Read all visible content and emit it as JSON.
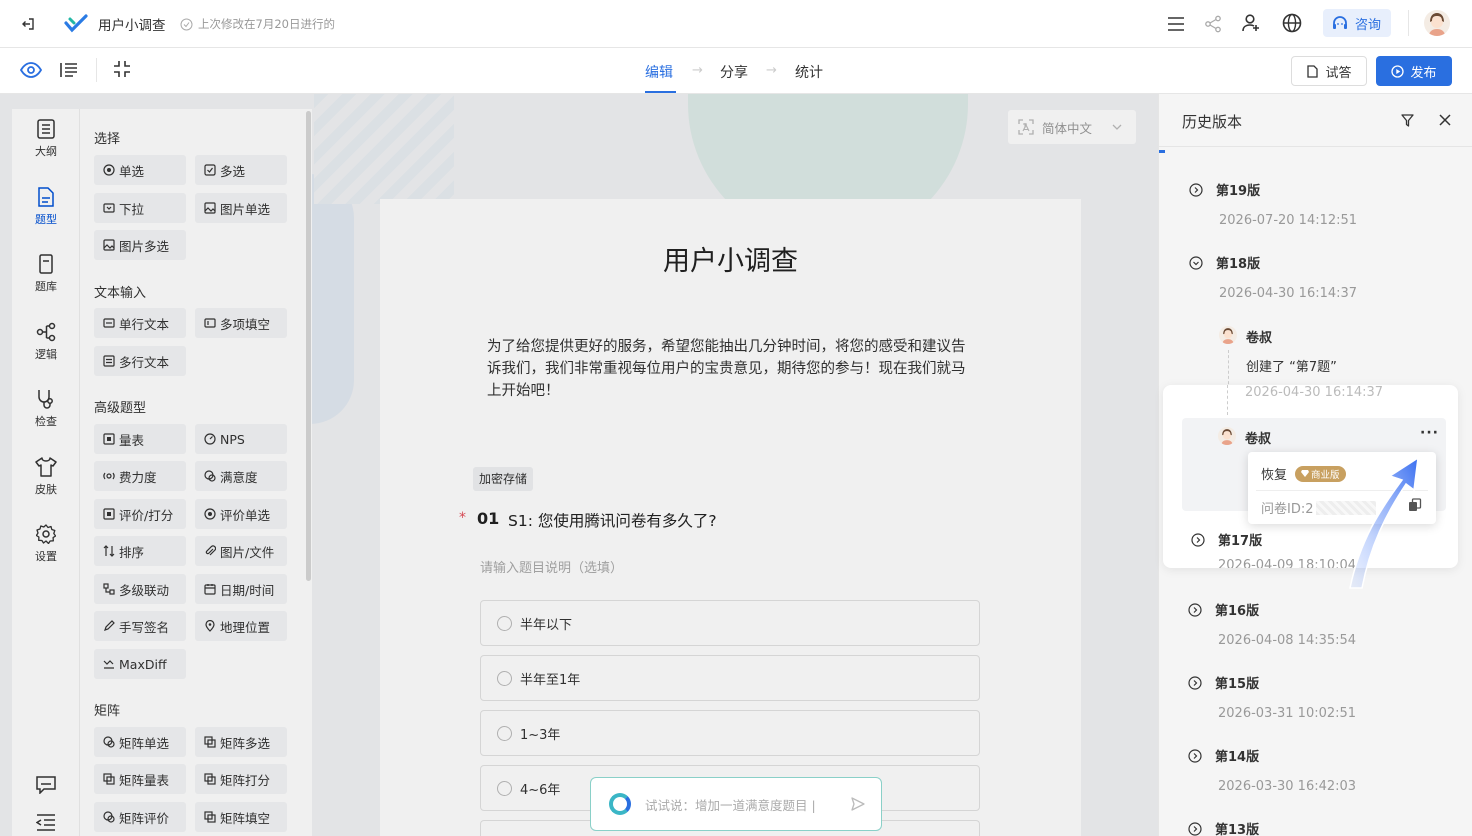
{
  "header": {
    "title": "用户小调查",
    "last_modified": "上次修改在7月20日进行的",
    "consult_label": "咨询"
  },
  "steps": {
    "edit": "编辑",
    "share": "分享",
    "stats": "统计"
  },
  "actions": {
    "preview": "试答",
    "publish": "发布"
  },
  "nav": {
    "outline": "大纲",
    "types": "题型",
    "bank": "题库",
    "logic": "逻辑",
    "check": "检查",
    "skin": "皮肤",
    "settings": "设置"
  },
  "palette": {
    "s1": "选择",
    "single": "单选",
    "multi": "多选",
    "dropdown": "下拉",
    "img_single": "图片单选",
    "img_multi": "图片多选",
    "s2": "文本输入",
    "single_text": "单行文本",
    "multi_fill": "多项填空",
    "multi_text": "多行文本",
    "s3": "高级题型",
    "scale": "量表",
    "nps": "NPS",
    "effort": "费力度",
    "satisfaction": "满意度",
    "rating": "评价/打分",
    "rating_single": "评价单选",
    "sort": "排序",
    "file": "图片/文件",
    "cascade": "多级联动",
    "datetime": "日期/时间",
    "signature": "手写签名",
    "location": "地理位置",
    "maxdiff": "MaxDiff",
    "s4": "矩阵",
    "matrix_single": "矩阵单选",
    "matrix_multi": "矩阵多选",
    "matrix_scale": "矩阵量表",
    "matrix_score": "矩阵打分",
    "matrix_rating": "矩阵评价",
    "matrix_fill": "矩阵填空"
  },
  "survey": {
    "language": "简体中文",
    "title": "用户小调查",
    "intro": "为了给您提供更好的服务，希望您能抽出几分钟时间，将您的感受和建议告诉我们，我们非常重视每位用户的宝贵意见，期待您的参与！现在我们就马上开始吧！",
    "tag": "加密存储",
    "q_required": "*",
    "q_num": "01",
    "q_text": "S1: 您使用腾讯问卷有多久了?",
    "q_desc": "请输入题目说明（选填）",
    "options": [
      "半年以下",
      "半年至1年",
      "1~3年",
      "4~6年"
    ]
  },
  "ai": {
    "placeholder": "试试说：增加一道满意度题目 |"
  },
  "history": {
    "title": "历史版本",
    "v19": {
      "label": "第19版",
      "date": "2026-07-20 14:12:51"
    },
    "v18": {
      "label": "第18版",
      "date": "2026-04-30 16:14:37"
    },
    "entry1": {
      "user": "卷叔",
      "action": "创建了 “第7题”",
      "date": "2026-04-30 16:14:37"
    },
    "entry2": {
      "user": "卷叔"
    },
    "v17": {
      "label": "第17版",
      "date": "2026-04-09 18:10:04"
    },
    "v16": {
      "label": "第16版",
      "date": "2026-04-08 14:35:54"
    },
    "v15": {
      "label": "第15版",
      "date": "2026-03-31 10:02:51"
    },
    "v14": {
      "label": "第14版",
      "date": "2026-03-30 16:42:03"
    },
    "v13": {
      "label": "第13版"
    }
  },
  "popover": {
    "restore": "恢复",
    "badge": "商业版",
    "survey_id": "问卷ID:2"
  },
  "colors": {
    "accent": "#0052d9",
    "badge": "#c8a060",
    "ai_border": "#8ad0c8"
  }
}
